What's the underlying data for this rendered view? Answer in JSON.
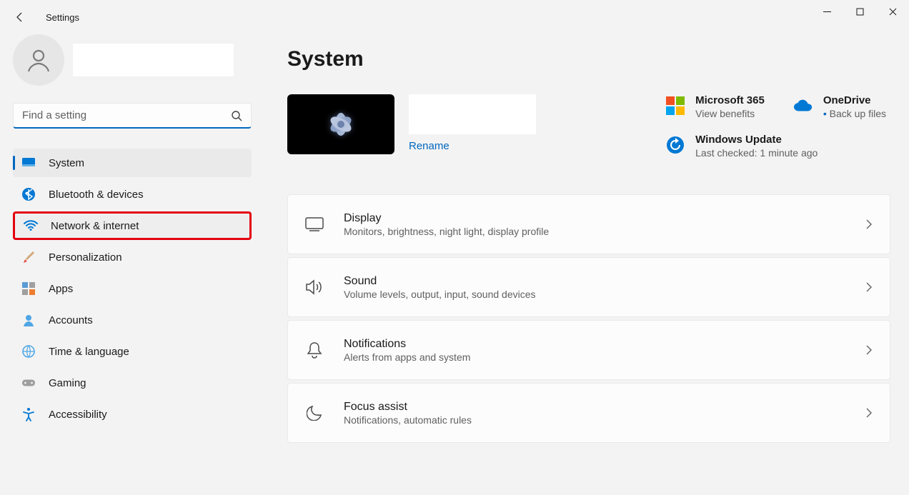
{
  "app": {
    "title": "Settings"
  },
  "search": {
    "placeholder": "Find a setting"
  },
  "sidebar": {
    "items": [
      {
        "label": "System"
      },
      {
        "label": "Bluetooth & devices"
      },
      {
        "label": "Network & internet"
      },
      {
        "label": "Personalization"
      },
      {
        "label": "Apps"
      },
      {
        "label": "Accounts"
      },
      {
        "label": "Time & language"
      },
      {
        "label": "Gaming"
      },
      {
        "label": "Accessibility"
      }
    ]
  },
  "page": {
    "title": "System",
    "rename": "Rename"
  },
  "cards": {
    "m365": {
      "title": "Microsoft 365",
      "sub": "View benefits"
    },
    "onedrive": {
      "title": "OneDrive",
      "sub": "Back up files"
    },
    "update": {
      "title": "Windows Update",
      "sub": "Last checked: 1 minute ago"
    }
  },
  "settings": [
    {
      "title": "Display",
      "sub": "Monitors, brightness, night light, display profile"
    },
    {
      "title": "Sound",
      "sub": "Volume levels, output, input, sound devices"
    },
    {
      "title": "Notifications",
      "sub": "Alerts from apps and system"
    },
    {
      "title": "Focus assist",
      "sub": "Notifications, automatic rules"
    }
  ]
}
